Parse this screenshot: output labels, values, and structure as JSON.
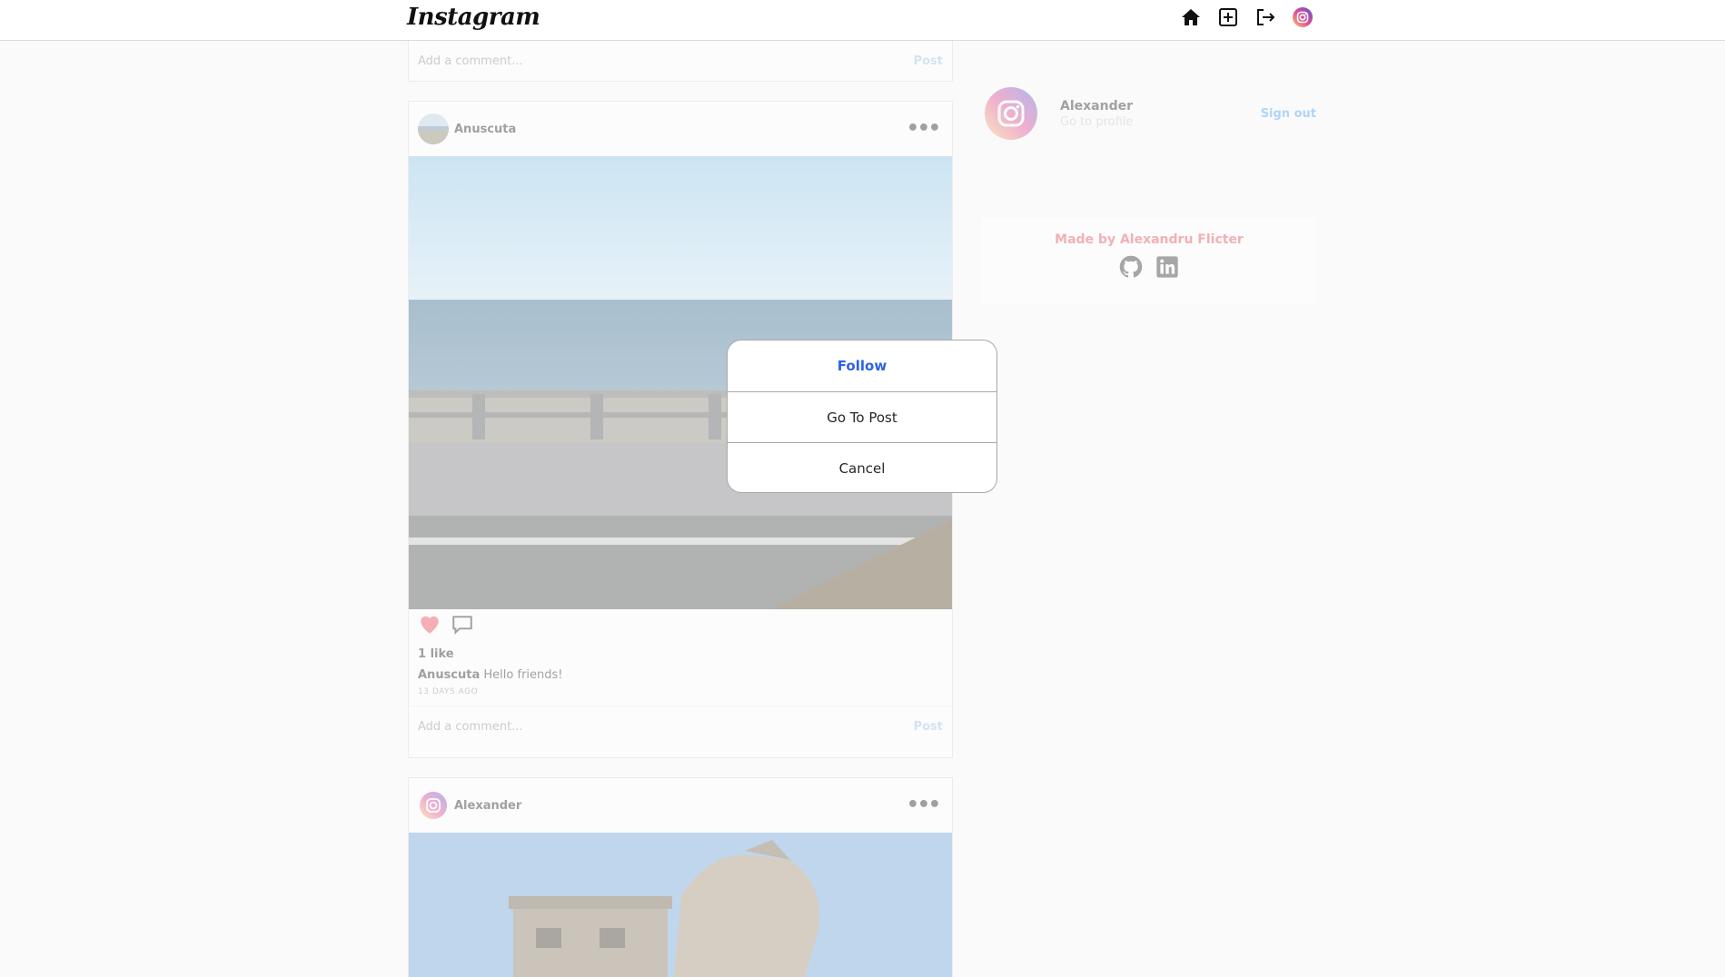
{
  "header": {
    "logo": "Instagram",
    "icons": [
      "home-icon",
      "add-post-icon",
      "logout-icon",
      "profile-icon"
    ]
  },
  "comment_box": {
    "placeholder": "Add a comment...",
    "post_label": "Post"
  },
  "posts": [
    {
      "username": "Anuscuta",
      "more": "•••",
      "likes": "1 like",
      "caption_user": "Anuscuta",
      "caption_text": "Hello friends!",
      "time_ago": "13 DAYS AGO"
    },
    {
      "username": "Alexander",
      "more": "•••"
    }
  ],
  "sidebar": {
    "name": "Alexander",
    "profile_link": "Go to profile",
    "signout": "Sign out",
    "credits": "Made by Alexandru Flicter",
    "credit_icons": [
      "github-icon",
      "linkedin-icon"
    ]
  },
  "modal": {
    "follow": "Follow",
    "go_to_post": "Go To Post",
    "cancel": "Cancel"
  },
  "colors": {
    "follow": "#2a63e3",
    "credits": "#ed4956",
    "post_button": "#9ac4ee",
    "signout": "#4aa3f5"
  }
}
